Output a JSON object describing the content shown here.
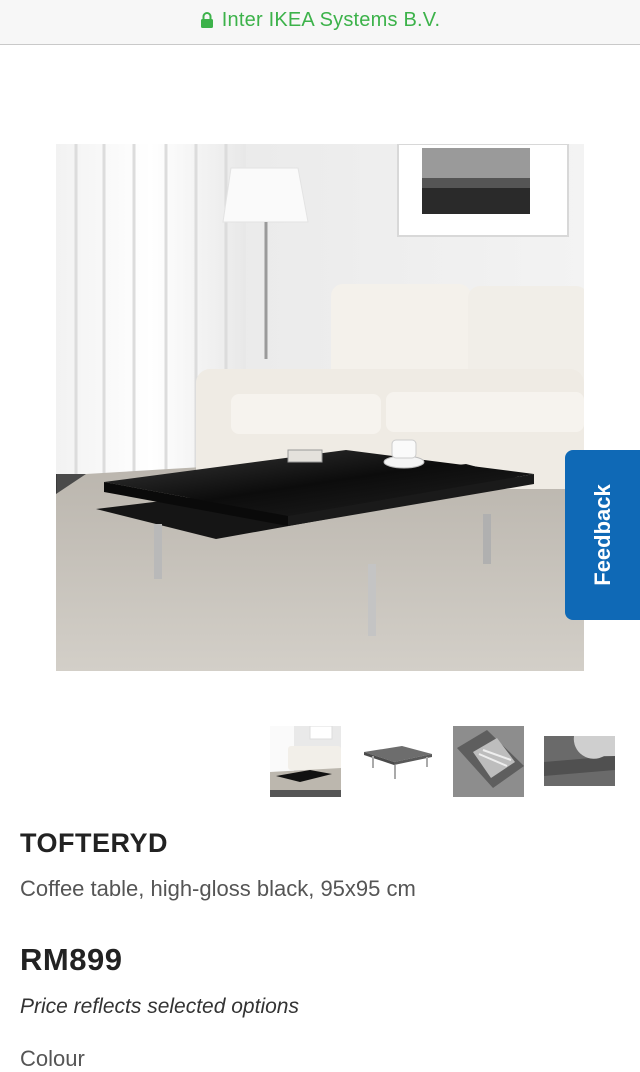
{
  "browser": {
    "site_name": "Inter IKEA Systems B.V.",
    "secure_icon": "lock-icon",
    "accent_color": "#3cb24a"
  },
  "feedback": {
    "label": "Feedback",
    "color": "#0f69b6"
  },
  "gallery": {
    "thumbnail_count": 4
  },
  "product": {
    "name": "TOFTERYD",
    "description": "Coffee table, high-gloss black, 95x95 cm",
    "price": "RM899",
    "price_note": "Price reflects selected options",
    "colour_label": "Colour"
  }
}
